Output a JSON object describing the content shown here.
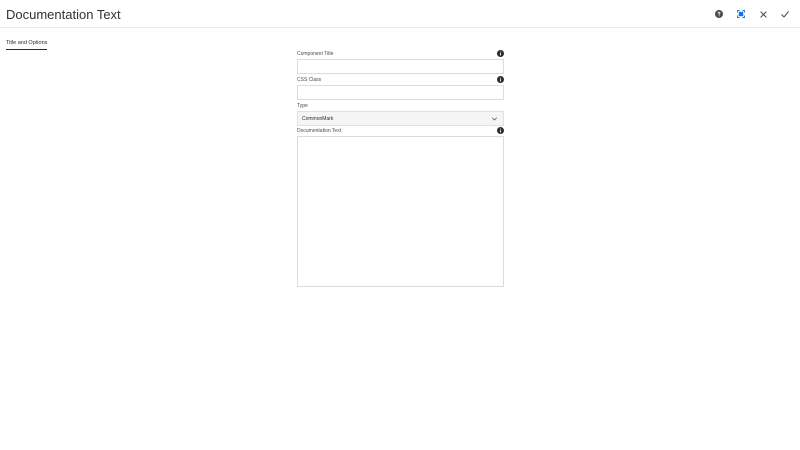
{
  "dialog": {
    "title": "Documentation Text"
  },
  "header": {
    "help_icon": "help-circle-icon",
    "fullscreen_icon": "fullscreen-icon",
    "close_icon": "close-icon",
    "confirm_icon": "checkmark-icon",
    "accent_color": "#1473e6"
  },
  "tabs": [
    {
      "label": "Title and Options",
      "selected": true
    }
  ],
  "fields": {
    "component_title": {
      "label": "Component Title",
      "value": "",
      "info_icon": "info-icon"
    },
    "css_class": {
      "label": "CSS Class",
      "value": "",
      "info_icon": "info-icon"
    },
    "type": {
      "label": "Type",
      "selected": "CommonMark"
    },
    "documentation_text": {
      "label": "Documentation Text",
      "value": "",
      "info_icon": "info-icon"
    }
  }
}
